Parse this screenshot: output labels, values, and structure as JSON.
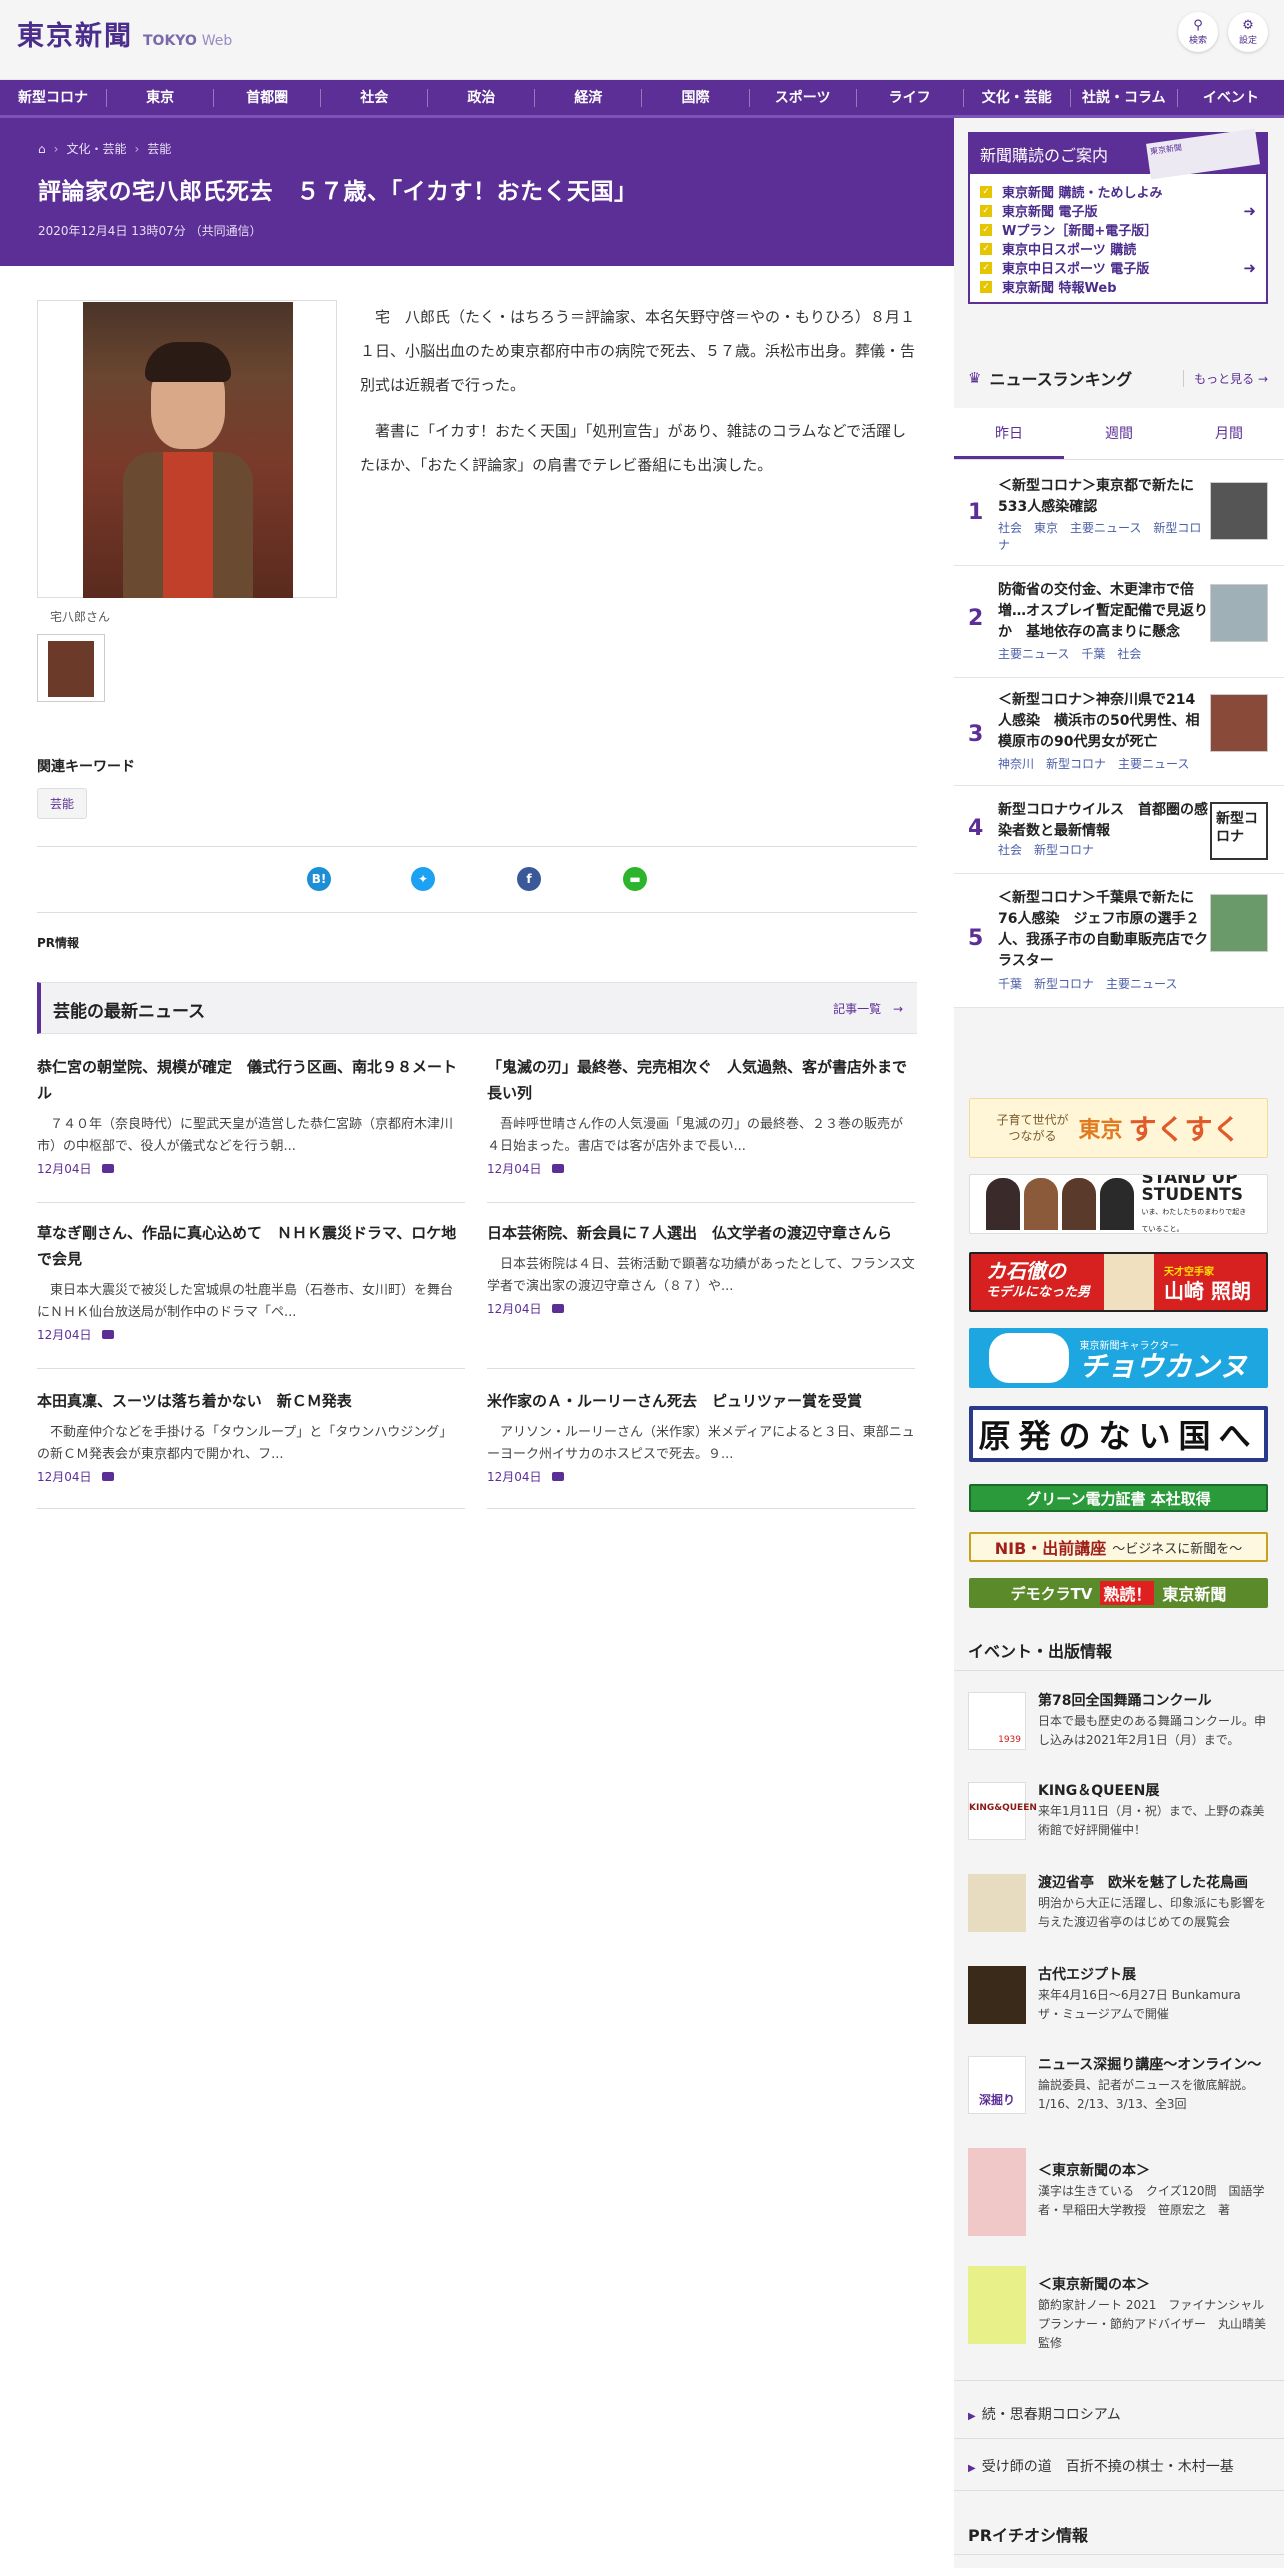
{
  "header": {
    "logo": "東京新聞",
    "logo_sub": "TOKYO",
    "logo_web": "Web",
    "search_label": "検索",
    "settings_label": "設定"
  },
  "nav": [
    "新型コロナ",
    "東京",
    "首都圏",
    "社会",
    "政治",
    "経済",
    "国際",
    "スポーツ",
    "ライフ",
    "文化・芸能",
    "社説・コラム",
    "イベント"
  ],
  "breadcrumb": [
    "文化・芸能",
    "芸能"
  ],
  "article": {
    "title": "評論家の宅八郎氏死去　５７歳、「イカす！おたく天国」",
    "date": "2020年12月4日 13時07分 （共同通信）",
    "photo_caption": "宅八郎さん",
    "paragraphs": [
      "宅　八郎氏（たく・はちろう＝評論家、本名矢野守啓＝やの・もりひろ）８月１１日、小脳出血のため東京都府中市の病院で死去、５７歳。浜松市出身。葬儀・告別式は近親者で行った。",
      "著書に「イカす！おたく天国」「処刑宣告」があり、雑誌のコラムなどで活躍したほか、「おたく評論家」の肩書でテレビ番組にも出演した。"
    ],
    "keywords_heading": "関連キーワード",
    "keyword": "芸能",
    "pr": "PR情報"
  },
  "latest": {
    "heading": "芸能の最新ニュース",
    "more": "記事一覧",
    "items": [
      {
        "title": "恭仁宮の朝堂院、規模が確定　儀式行う区画、南北９８メートル",
        "desc": "７４０年（奈良時代）に聖武天皇が造営した恭仁宮跡（京都府木津川市）の中枢部で、役人が儀式などを行う朝...",
        "date": "12月04日"
      },
      {
        "title": "「鬼滅の刃」最終巻、完売相次ぐ　人気過熱、客が書店外まで長い列",
        "desc": "吾峠呼世晴さん作の人気漫画「鬼滅の刃」の最終巻、２３巻の販売が４日始まった。書店では客が店外まで長い...",
        "date": "12月04日"
      },
      {
        "title": "草なぎ剛さん、作品に真心込めて　ＮＨＫ震災ドラマ、ロケ地で会見",
        "desc": "東日本大震災で被災した宮城県の牡鹿半島（石巻市、女川町）を舞台にＮＨＫ仙台放送局が制作中のドラマ「ペ...",
        "date": "12月04日"
      },
      {
        "title": "日本芸術院、新会員に７人選出　仏文学者の渡辺守章さんら",
        "desc": "日本芸術院は４日、芸術活動で顕著な功績があったとして、フランス文学者で演出家の渡辺守章さん（８７）や...",
        "date": "12月04日"
      },
      {
        "title": "本田真凜、スーツは落ち着かない　新ＣＭ発表",
        "desc": "不動産仲介などを手掛ける「タウンループ」と「タウンハウジング」の新ＣＭ発表会が東京都内で開かれ、フ...",
        "date": "12月04日"
      },
      {
        "title": "米作家のＡ・ルーリーさん死去　ピュリツァー賞を受賞",
        "desc": "アリソン・ルーリーさん（米作家）米メディアによると３日、東部ニューヨーク州イサカのホスピスで死去。９...",
        "date": "12月04日"
      }
    ]
  },
  "subscribe": {
    "heading": "新聞購読のご案内",
    "paper_text": "東京新聞",
    "items": [
      "東京新聞 購読・ためしよみ",
      "東京新聞 電子版",
      "Wプラン［新聞+電子版］",
      "東京中日スポーツ 購読",
      "東京中日スポーツ 電子版",
      "東京新聞 特報Web"
    ]
  },
  "ranking": {
    "heading": "ニュースランキング",
    "more": "もっと見る",
    "tabs": [
      "昨日",
      "週間",
      "月間"
    ],
    "items": [
      {
        "num": "1",
        "title": "＜新型コロナ＞東京都で新たに533人感染確認",
        "tags": "社会　東京　主要ニュース　新型コロナ"
      },
      {
        "num": "2",
        "title": "防衛省の交付金、木更津市で倍増…オスプレイ暫定配備で見返りか　基地依存の高まりに懸念",
        "tags": "主要ニュース　千葉　社会"
      },
      {
        "num": "3",
        "title": "＜新型コロナ＞神奈川県で214人感染　横浜市の50代男性、相模原市の90代男女が死亡",
        "tags": "神奈川　新型コロナ　主要ニュース"
      },
      {
        "num": "4",
        "title": "新型コロナウイルス　首都圏の感染者数と最新情報",
        "tags": "社会　新型コロナ"
      },
      {
        "num": "5",
        "title": "＜新型コロナ＞千葉県で新たに76人感染　ジェフ市原の選手２人、我孫子市の自動車販売店でクラスター",
        "tags": "千葉　新型コロナ　主要ニュース"
      }
    ],
    "thumb4": "新型コロナ"
  },
  "banners": {
    "b1a": "子育て世代が",
    "b1b": "つながる",
    "b1c": "東京",
    "b1d": "すくすく",
    "b2a": "STAND UP",
    "b2b": "STUDENTS",
    "b2c": "いま、わたしたちのまわりで起きていること。",
    "b3a": "カ石徹の",
    "b3b": "モデルに",
    "b3c": "なった男",
    "b3d": "天才空手家",
    "b3e": "山崎 照朗",
    "b4a": "東京新聞キャラクター",
    "b4b": "チョウカンヌ",
    "b5": "原発のない国へ",
    "b6": "グリーン電力証書 本社取得",
    "b7a": "NIB・出前講座",
    "b7b": "〜ビジネスに新聞を〜",
    "b8a": "デモクラTV",
    "b8b": "熟読！",
    "b8c": "東京新聞"
  },
  "events": {
    "heading": "イベント・出版情報",
    "items": [
      {
        "title": "第78回全国舞踊コンクール",
        "desc": "日本で最も歴史のある舞踊コンクール。申し込みは2021年2月1日（月）まで。"
      },
      {
        "title": "KING＆QUEEN展",
        "desc": "来年1月11日（月・祝）まで、上野の森美術館で好評開催中！"
      },
      {
        "title": "渡辺省亭　欧米を魅了した花鳥画",
        "desc": "明治から大正に活躍し、印象派にも影響を与えた渡辺省亭のはじめての展覧会"
      },
      {
        "title": "古代エジプト展",
        "desc": "来年4月16日～6月27日 Bunkamura ザ・ミュージアムで開催"
      },
      {
        "title": "ニュース深掘り講座～オンライン～",
        "desc": "論説委員、記者がニュースを徹底解説。1/16、2/13、3/13、全3回"
      },
      {
        "title": "＜東京新聞の本＞",
        "desc": "漢字は生きている　クイズ120問　国語学者・早稲田大学教授　笹原宏之　著"
      },
      {
        "title": "＜東京新聞の本＞",
        "desc": "節約家計ノート 2021　ファイナンシャルプランナー・節約アドバイザー　丸山晴美　監修"
      }
    ],
    "logo1": "1939",
    "logo2": "KING&QUEEN",
    "logo5": "深掘り",
    "links": [
      "続・思春期コロシアム",
      "受け師の道　百折不撓の棋士・木村一基"
    ],
    "pr_heading": "PRイチオシ情報"
  }
}
